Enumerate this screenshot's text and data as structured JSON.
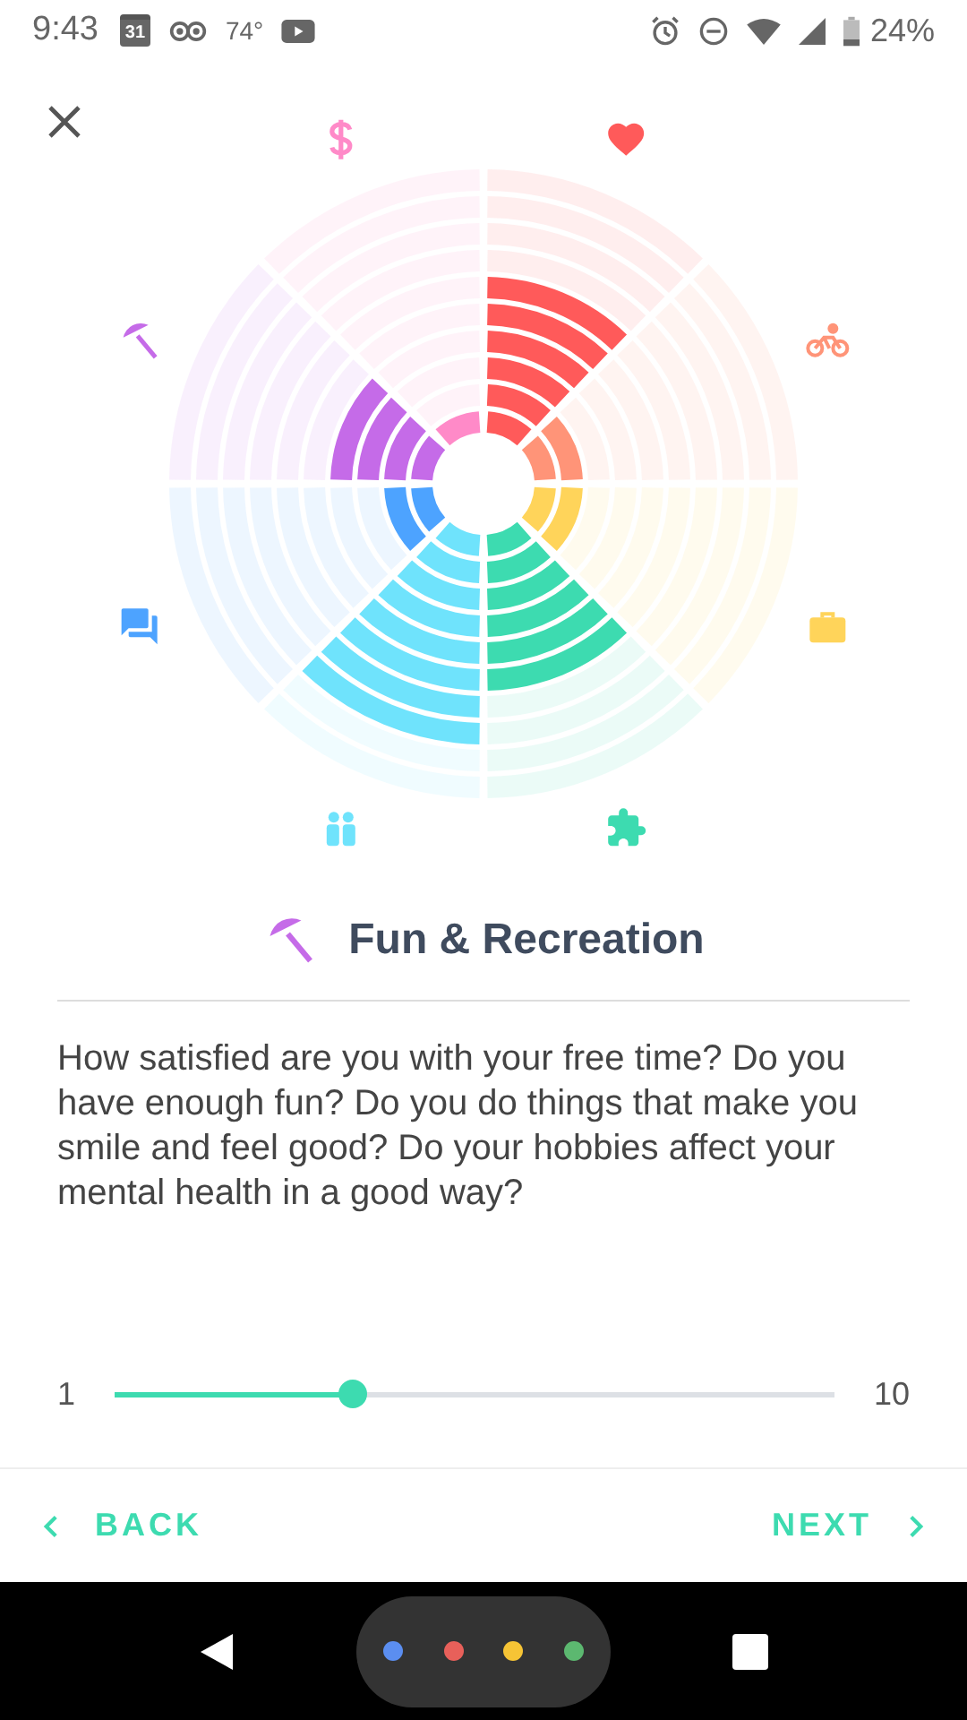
{
  "status_bar": {
    "time": "9:43",
    "calendar_day": "31",
    "temperature": "74°",
    "battery": "24%"
  },
  "wheel": {
    "sectors": [
      {
        "level": 0.6,
        "color": "#ff5a5a"
      },
      {
        "level": 0.2,
        "color": "#ff9478"
      },
      {
        "level": 0.2,
        "color": "#ffd45a"
      },
      {
        "level": 0.6,
        "color": "#3ddbb0"
      },
      {
        "level": 0.8,
        "color": "#6fe3fc"
      },
      {
        "level": 0.2,
        "color": "#4da3ff"
      },
      {
        "level": 0.4,
        "color": "#c56be8"
      },
      {
        "level": 0.1,
        "color": "#ff8ac8"
      }
    ]
  },
  "category": {
    "title": "Fun & Recreation"
  },
  "question": "How satisfied are you with your free time? Do you have enough fun? Do you do things that make you smile and feel good? Do your hobbies affect your mental health in a good way?",
  "slider": {
    "min_label": "1",
    "max_label": "10",
    "level": 0.33
  },
  "nav": {
    "back": "BACK",
    "next": "NEXT"
  }
}
